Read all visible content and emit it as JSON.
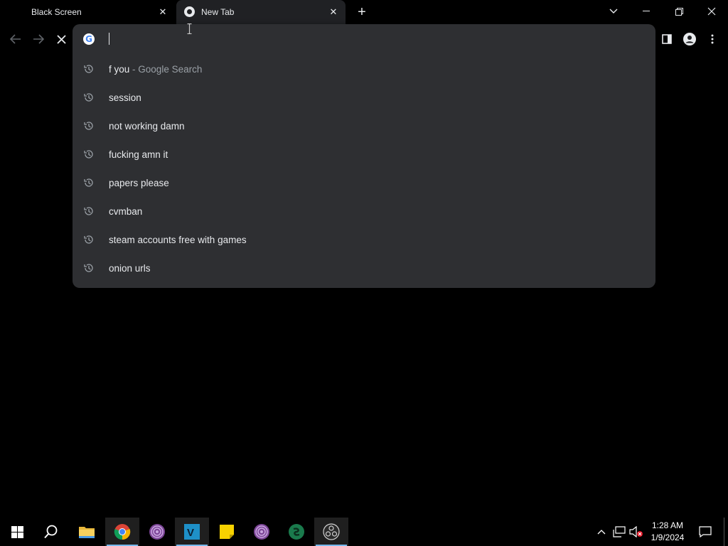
{
  "tabs": [
    {
      "title": "Black Screen",
      "active": false
    },
    {
      "title": "New Tab",
      "active": true
    }
  ],
  "omnibox": {
    "value": "",
    "suggestions": [
      {
        "text": "f you",
        "sub": "- Google Search"
      },
      {
        "text": "session",
        "sub": ""
      },
      {
        "text": "not working damn",
        "sub": ""
      },
      {
        "text": "fucking amn it",
        "sub": ""
      },
      {
        "text": "papers please",
        "sub": ""
      },
      {
        "text": "cvmban",
        "sub": ""
      },
      {
        "text": "steam accounts free with games",
        "sub": ""
      },
      {
        "text": "onion urls",
        "sub": ""
      }
    ]
  },
  "taskbar": {
    "time": "1:28 AM",
    "date": "1/9/2024"
  },
  "colors": {
    "background": "#000000",
    "omnibox_bg": "#2e2f32",
    "tab_active_bg": "#202124",
    "text": "#e8eaed",
    "subtext": "#9aa0a6",
    "taskbar_indicator": "#76b9ed"
  }
}
